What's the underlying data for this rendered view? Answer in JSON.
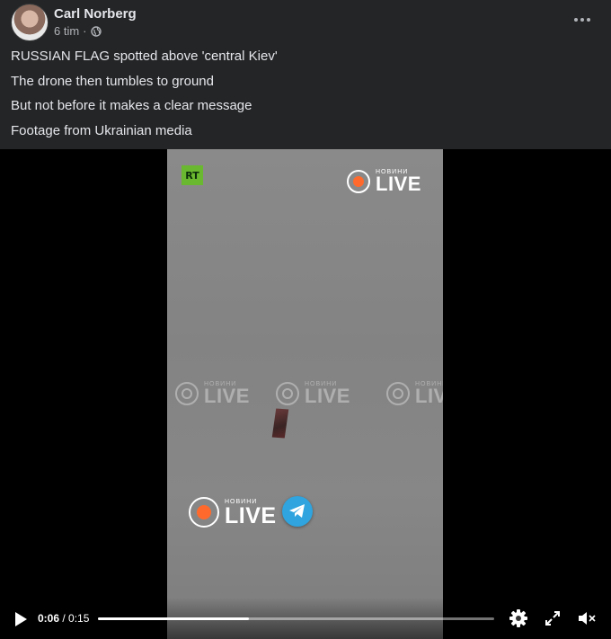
{
  "post": {
    "author": "Carl Norberg",
    "time": "6 tim",
    "separator": "·",
    "privacy_icon": "globe-icon",
    "lines": [
      "RUSSIAN FLAG spotted above 'central Kiev'",
      "The drone then tumbles to ground",
      "But not before it makes a clear message",
      "Footage from Ukrainian media"
    ]
  },
  "video": {
    "rt_logo": "RT",
    "watermark_small": "НОВИНИ",
    "watermark_big": "LIVE",
    "telegram_icon": "telegram-icon",
    "colors": {
      "live_dot": "#ff6a2c",
      "rt_green": "#6ab82f",
      "telegram": "#2fa4de"
    }
  },
  "player": {
    "current_time": "0:06",
    "duration": "0:15",
    "time_separator": " / ",
    "progress": 0.38,
    "play_icon": "play-icon",
    "settings_icon": "gear-icon",
    "fullscreen_icon": "fullscreen-icon",
    "mute_icon": "muted-volume-icon"
  }
}
